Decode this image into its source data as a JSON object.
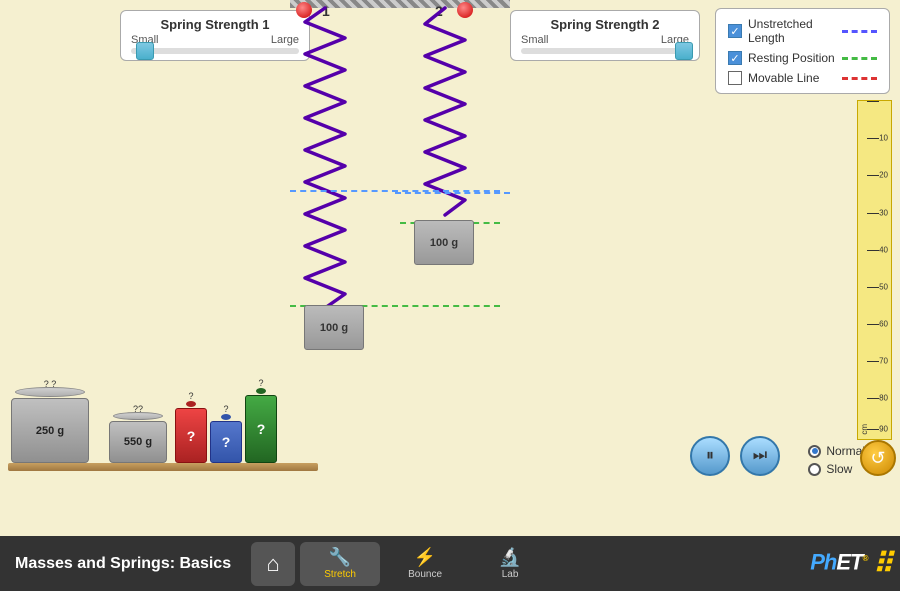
{
  "app": {
    "title": "Masses and Springs: Basics"
  },
  "spring1": {
    "title": "Spring Strength 1",
    "small_label": "Small",
    "large_label": "Large",
    "thumb_position": "left"
  },
  "spring2": {
    "title": "Spring Strength 2",
    "small_label": "Small",
    "large_label": "Large",
    "thumb_position": "right"
  },
  "legend": {
    "items": [
      {
        "label": "Unstretched Length",
        "checked": true,
        "color": "#5555ff",
        "line_style": "dashed"
      },
      {
        "label": "Resting Position",
        "checked": true,
        "color": "#44bb44",
        "line_style": "dashed"
      },
      {
        "label": "Movable Line",
        "checked": false,
        "color": "#dd3333",
        "line_style": "dashed"
      }
    ]
  },
  "spring_labels": {
    "label1": "1",
    "label2": "2"
  },
  "masses": {
    "hanging": [
      {
        "id": "mass1",
        "label": "100 g"
      },
      {
        "id": "mass2",
        "label": "100 g"
      }
    ],
    "shelf": [
      {
        "id": "mass250",
        "label": "250 g"
      },
      {
        "id": "mass550",
        "label": "550 g"
      }
    ],
    "unknown": [
      {
        "color": "#cc3333",
        "symbol": "?"
      },
      {
        "color": "#4466cc",
        "symbol": "?"
      },
      {
        "color": "#228833",
        "symbol": "?"
      }
    ]
  },
  "ruler": {
    "unit": "cm",
    "ticks": [
      "10",
      "20",
      "30",
      "40",
      "50",
      "60",
      "70",
      "80",
      "90"
    ]
  },
  "controls": {
    "pause_label": "⏸",
    "step_label": "⏭",
    "speed_normal": "Normal",
    "speed_slow": "Slow",
    "reset_label": "↺"
  },
  "nav": {
    "home_icon": "⌂",
    "tabs": [
      {
        "label": "Stretch",
        "active": true,
        "icon": "🔧"
      },
      {
        "label": "Bounce",
        "active": false,
        "icon": "⚡"
      },
      {
        "label": "Lab",
        "active": false,
        "icon": "🔬"
      }
    ]
  },
  "phet": {
    "logo": "PhET"
  }
}
